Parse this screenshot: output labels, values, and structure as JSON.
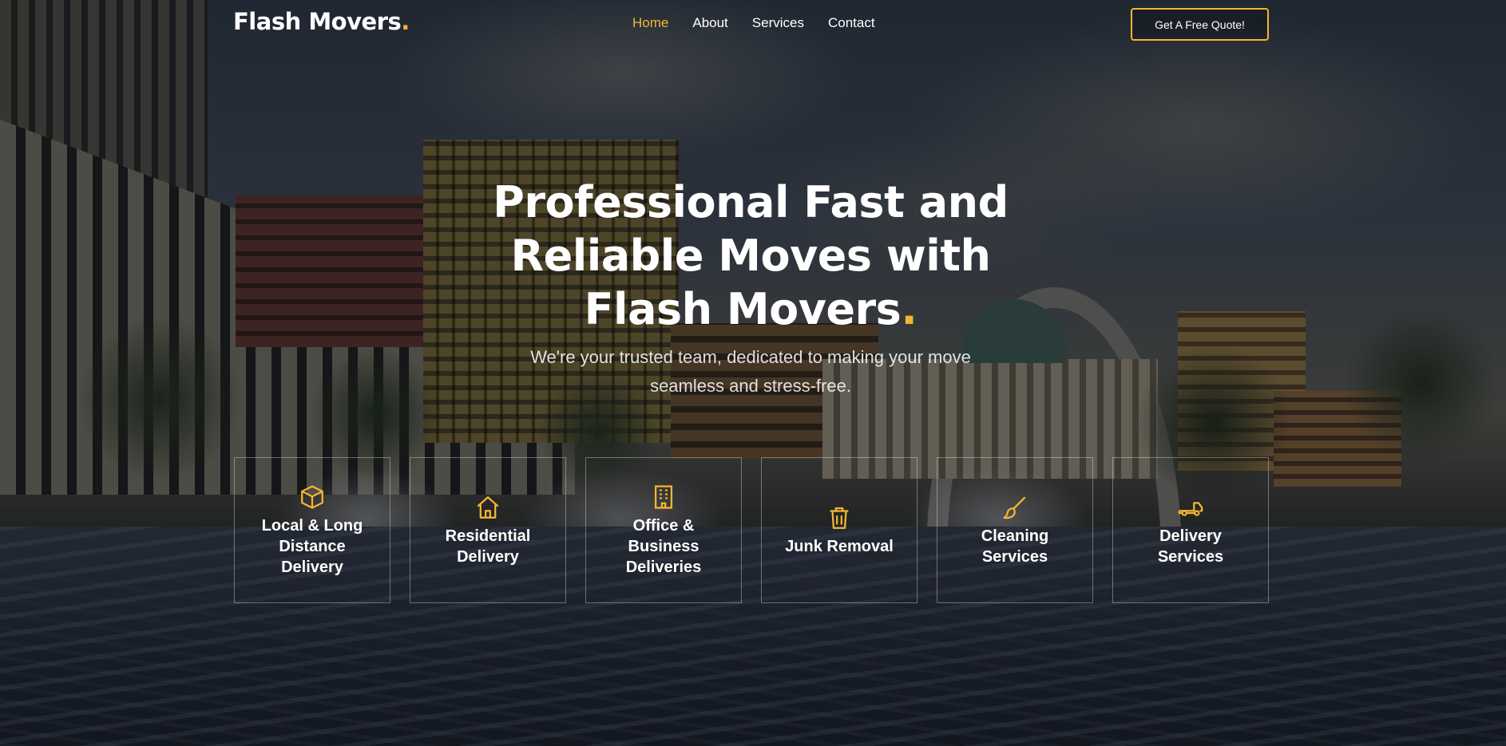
{
  "brand": {
    "name": "Flash Movers",
    "dot": "."
  },
  "nav": {
    "items": [
      {
        "label": "Home",
        "active": true
      },
      {
        "label": "About",
        "active": false
      },
      {
        "label": "Services",
        "active": false
      },
      {
        "label": "Contact",
        "active": false
      }
    ],
    "cta_label": "Get A Free Quote!"
  },
  "hero": {
    "title_lines": [
      "Professional Fast and",
      "Reliable Moves with",
      "Flash Movers"
    ],
    "title_dot": ".",
    "subtitle": "We're your trusted team, dedicated to making your move seamless and stress-free."
  },
  "services": [
    {
      "icon": "box-icon",
      "label": "Local & Long Distance Delivery"
    },
    {
      "icon": "house-icon",
      "label": "Residential Delivery"
    },
    {
      "icon": "building-icon",
      "label": "Office & Business Deliveries"
    },
    {
      "icon": "trash-icon",
      "label": "Junk Removal"
    },
    {
      "icon": "brush-icon",
      "label": "Cleaning Services"
    },
    {
      "icon": "truck-icon",
      "label": "Delivery Services"
    }
  ],
  "colors": {
    "accent": "#f5b533",
    "text": "#ffffff"
  }
}
